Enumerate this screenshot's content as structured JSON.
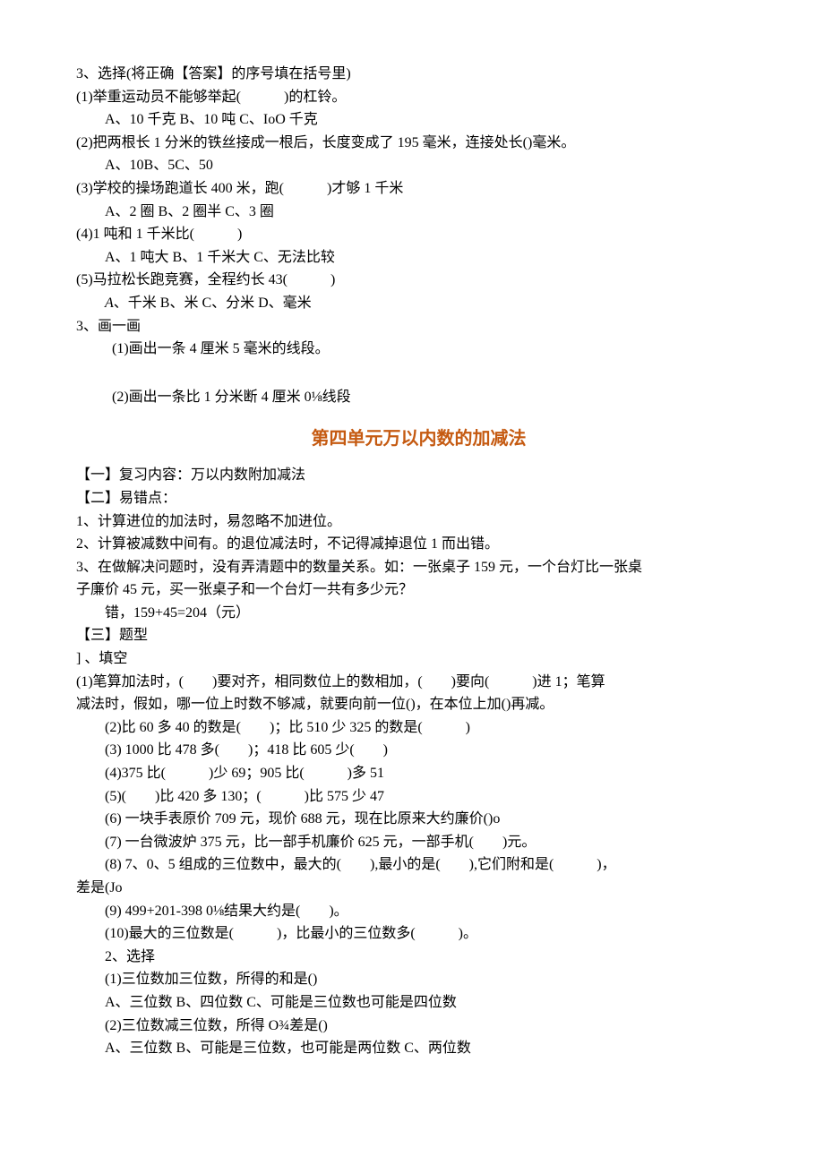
{
  "top": {
    "q3_title": "3、选择(将正确【答案】的序号填在括号里)",
    "q3_1": "(1)举重运动员不能够举起(　　　)的杠铃。",
    "q3_1_opts": "A、10 千克 B、10 吨 C、IoO 千克",
    "q3_2": "(2)把两根长 1 分米的铁丝接成一根后，长度变成了 195 毫米，连接处长()毫米。",
    "q3_2_opts": "A、10B、5C、50",
    "q3_3": "(3)学校的操场跑道长 400 米，跑(　　　)才够 1 千米",
    "q3_3_opts": "A、2 圈 B、2 圈半 C、3 圈",
    "q3_4": "(4)1 吨和 1 千米比(　　　)",
    "q3_4_opts": "A、1 吨大 B、1 千米大 C、无法比较",
    "q3_5": "(5)马拉松长跑竞赛，全程约长 43(　　　)",
    "q3_5_opts_prefix": "A",
    "q3_5_opts_rest": "、千米 B、米 C、分米 D、毫米",
    "q3b_title": "3、画一画",
    "q3b_1": "(1)画出一条 4 厘米 5 毫米的线段。",
    "q3b_2": "(2)画出一条比 1 分米断 4 厘米 0⅛线段"
  },
  "section_title": "第四单元万以内数的加减法",
  "bottom": {
    "p1": "【一】复习内容：万以内数附加减法",
    "p2": "【二】易错点：",
    "e1": "1、计算进位的加法时，易忽略不加进位。",
    "e2": "2、计算被减数中间有。的退位减法时，不记得减掉退位 1 而出错。",
    "e3a": "3、在做解决问题时，没有弄清题中的数量关系。如：一张桌子 159 元，一个台灯比一张桌",
    "e3b": "子廉价 45 元，买一张桌子和一个台灯一共有多少元？",
    "e3c": "错，159+45=204（元）",
    "p3": "【三】题型",
    "t1_title": "] 、填空",
    "t1_1a": "(1)笔算加法时，(　　)要对齐，相同数位上的数相加，(　　)要向(　　　)进 1；笔算",
    "t1_1b": "减法时，假如，哪一位上时数不够减，就要向前一位()，在本位上加()再减。",
    "t1_2": "(2)比 60 多 40 的数是(　　)；比 510 少 325 的数是(　　　)",
    "t1_3": "(3)  1000 比 478 多(　　)；418 比 605 少(　　)",
    "t1_4": "(4)375 比(　　　)少 69；905 比(　　　)多 51",
    "t1_5": "(5)(　　)比 420 多 130；(　　　)比 575 少 47",
    "t1_6": "(6)  一块手表原价 709 元，现价 688 元，现在比原来大约廉价()o",
    "t1_7": "(7)  一台微波炉 375 元，比一部手机廉价 625 元，一部手机(　　)元。",
    "t1_8a": "(8)  7、0、5 组成的三位数中，最大的(　　),最小的是(　　),它们附和是(　　　)，",
    "t1_8b": "差是(Jo",
    "t1_9": "(9)  499+201-398 0⅛结果大约是(　　)。",
    "t1_10": "(10)最大的三位数是(　　　)，比最小的三位数多(　　　)。",
    "t2_title": "2、选择",
    "t2_1": "(1)三位数加三位数，所得的和是()",
    "t2_1_opts": "A、三位数 B、四位数 C、可能是三位数也可能是四位数",
    "t2_2": "(2)三位数减三位数，所得 O¾差是()",
    "t2_2_opts": "A、三位数 B、可能是三位数，也可能是两位数 C、两位数"
  }
}
